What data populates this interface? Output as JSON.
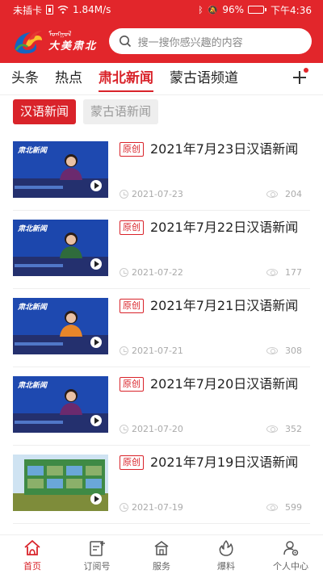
{
  "status_bar": {
    "carrier": "未插卡",
    "speed": "1.84M/s",
    "battery": "96%",
    "battery_level": 0.96,
    "time": "下午4:36"
  },
  "header": {
    "logo_mongolian": "ᠮᠣᠩᠭᠣᠯ",
    "logo_text": "大美肃北",
    "search_placeholder": "搜一搜你感兴趣的内容",
    "brand_color": "#e2262b"
  },
  "channels": {
    "tabs": [
      {
        "label": "头条",
        "active": false
      },
      {
        "label": "热点",
        "active": false
      },
      {
        "label": "肃北新闻",
        "active": true
      },
      {
        "label": "蒙古语频道",
        "active": false
      }
    ],
    "add_icon": "plus-icon"
  },
  "subtabs": [
    {
      "label": "汉语新闻",
      "active": true
    },
    {
      "label": "蒙古语新闻",
      "active": false
    }
  ],
  "news": [
    {
      "badge": "原创",
      "title": "2021年7月23日汉语新闻",
      "date": "2021-07-23",
      "views": "204",
      "thumb": "female-anchor-purple"
    },
    {
      "badge": "原创",
      "title": "2021年7月22日汉语新闻",
      "date": "2021-07-22",
      "views": "177",
      "thumb": "male-anchor-green"
    },
    {
      "badge": "原创",
      "title": "2021年7月21日汉语新闻",
      "date": "2021-07-21",
      "views": "308",
      "thumb": "female-anchor-orange"
    },
    {
      "badge": "原创",
      "title": "2021年7月20日汉语新闻",
      "date": "2021-07-20",
      "views": "352",
      "thumb": "female-anchor-purple"
    },
    {
      "badge": "原创",
      "title": "2021年7月19日汉语新闻",
      "date": "2021-07-19",
      "views": "599",
      "thumb": "outdoor-billboard"
    }
  ],
  "bottom_nav": [
    {
      "label": "首页",
      "icon": "home-icon",
      "active": true
    },
    {
      "label": "订阅号",
      "icon": "subscribe-icon",
      "active": false
    },
    {
      "label": "服务",
      "icon": "service-icon",
      "active": false
    },
    {
      "label": "爆料",
      "icon": "fire-icon",
      "active": false
    },
    {
      "label": "个人中心",
      "icon": "user-settings-icon",
      "active": false
    }
  ]
}
